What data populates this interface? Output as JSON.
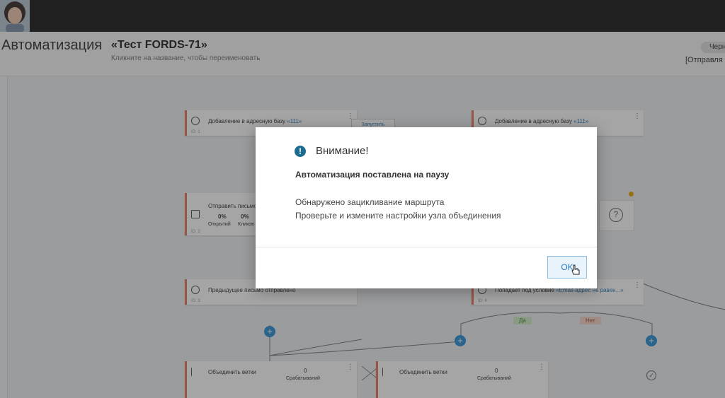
{
  "header": {
    "page_title": "Автоматизация",
    "automation_name": "«Тест FORDS-71»",
    "rename_hint": "Кликните на название, чтобы переименовать",
    "draft_badge": "Черн",
    "status": "[Отправля"
  },
  "canvas": {
    "nodes": [
      {
        "label": "Добавление в адресную базу",
        "link": "«111»",
        "id": "ID: 1"
      },
      {
        "label": "Добавление в адресную базу",
        "link": "«111»",
        "id": ""
      },
      {
        "label": "Отправить письмо",
        "link": "",
        "id": "ID: 2"
      },
      {
        "label": "Предыдущее письмо отправлено",
        "link": "",
        "id": "ID: 3"
      },
      {
        "label": "Попадает под условие",
        "link": "«Email-адрес не равен...»",
        "id": "ID: 4"
      },
      {
        "label": "Объединить ветки",
        "link": "",
        "id": ""
      },
      {
        "label": "Объединить ветки",
        "link": "",
        "id": ""
      }
    ],
    "stats": {
      "opens_value": "0%",
      "opens_label": "Открытий",
      "clicks_value": "0%",
      "clicks_label": "Кликов"
    },
    "merge_count": "0",
    "merge_count_label": "Срабатываний",
    "branch_yes": "Да",
    "branch_no": "Нет",
    "partial_button": "Запустить",
    "question_glyph": "?"
  },
  "modal": {
    "title": "Внимание!",
    "subtitle": "Автоматизация поставлена на паузу",
    "line1": "Обнаружено зацикливание маршрута",
    "line2": "Проверьте и измените настройки узла объединения",
    "ok_label": "OK"
  },
  "colors": {
    "accent": "#2c8fd6",
    "node_border": "#e8775a",
    "info_icon": "#1d6b8e"
  }
}
